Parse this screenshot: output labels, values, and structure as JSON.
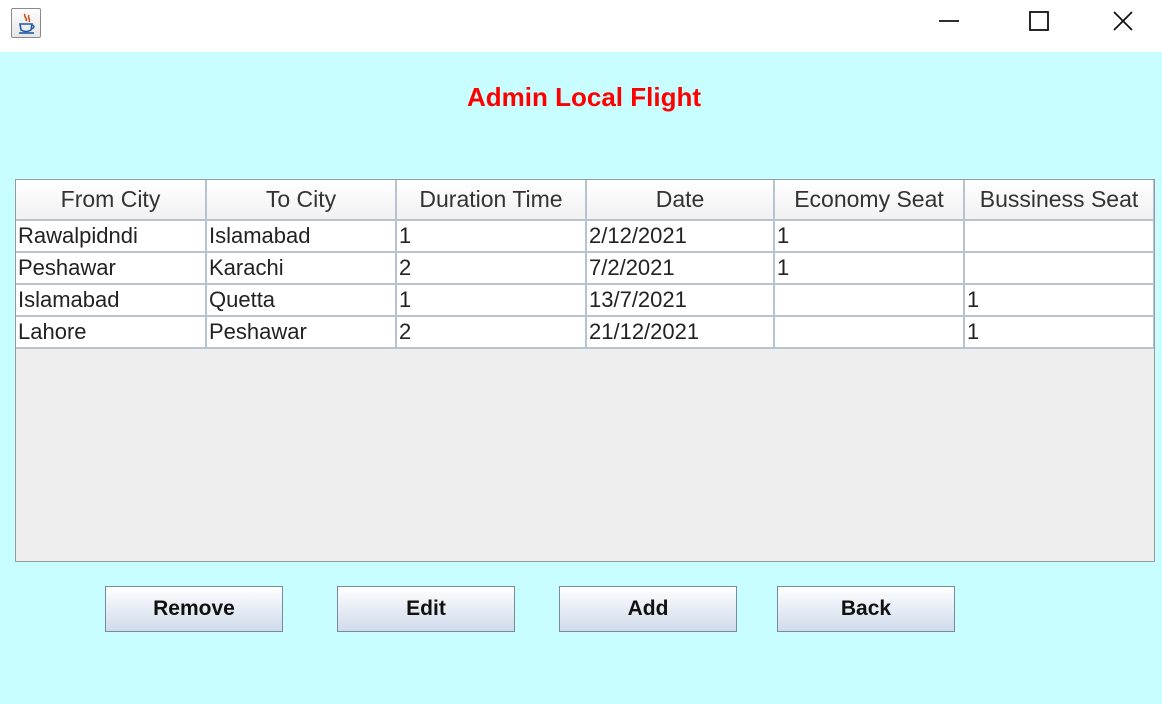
{
  "window": {
    "app_icon": "java-cup-icon",
    "controls": {
      "minimize_icon": "minimize-icon",
      "maximize_icon": "maximize-icon",
      "close_icon": "close-icon"
    }
  },
  "page": {
    "title": "Admin Local Flight",
    "title_color": "#ff0000",
    "background_color": "#c8feff"
  },
  "table": {
    "columns": [
      "From City",
      "To City",
      "Duration Time",
      "Date",
      "Economy Seat",
      "Bussiness Seat"
    ],
    "rows": [
      [
        "Rawalpidndi",
        "Islamabad",
        "1",
        "2/12/2021",
        "1",
        ""
      ],
      [
        "Peshawar",
        "Karachi",
        "2",
        "7/2/2021",
        "1",
        ""
      ],
      [
        "Islamabad",
        "Quetta",
        "1",
        "13/7/2021",
        "",
        "1"
      ],
      [
        "Lahore",
        "Peshawar",
        "2",
        "21/12/2021",
        "",
        "1"
      ]
    ]
  },
  "buttons": {
    "remove": "Remove",
    "edit": "Edit",
    "add": "Add",
    "back": "Back"
  }
}
